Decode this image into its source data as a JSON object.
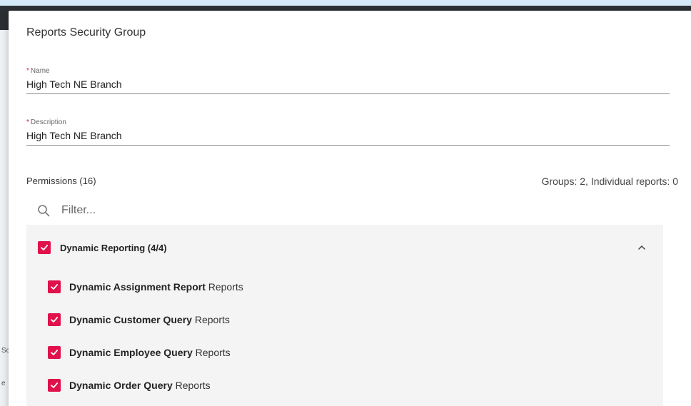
{
  "backdrop": {
    "fragments": [
      "Sc",
      "e"
    ]
  },
  "dialog": {
    "title": "Reports Security Group",
    "fields": {
      "name": {
        "required_mark": "*",
        "label": "Name",
        "value": "High Tech NE Branch"
      },
      "description": {
        "required_mark": "*",
        "label": "Description",
        "value": "High Tech NE Branch"
      }
    },
    "permissions": {
      "title": "Permissions (16)",
      "summary": "Groups: 2, Individual reports: 0",
      "filter_placeholder": "Filter...",
      "group": {
        "label": "Dynamic Reporting (4/4)",
        "checked": true,
        "expanded": true,
        "items": [
          {
            "name": "Dynamic Assignment Report",
            "suffix": "Reports",
            "checked": true
          },
          {
            "name": "Dynamic Customer Query",
            "suffix": "Reports",
            "checked": true
          },
          {
            "name": "Dynamic Employee Query",
            "suffix": "Reports",
            "checked": true
          },
          {
            "name": "Dynamic Order Query",
            "suffix": "Reports",
            "checked": true
          }
        ]
      }
    }
  },
  "colors": {
    "accent": "#e0114b",
    "panel": "#f4f4f4",
    "backdrop": "#d4e9f7"
  },
  "icons": {
    "filter": "search-icon",
    "checkbox": "checkmark-icon",
    "collapse": "chevron-up-icon"
  }
}
